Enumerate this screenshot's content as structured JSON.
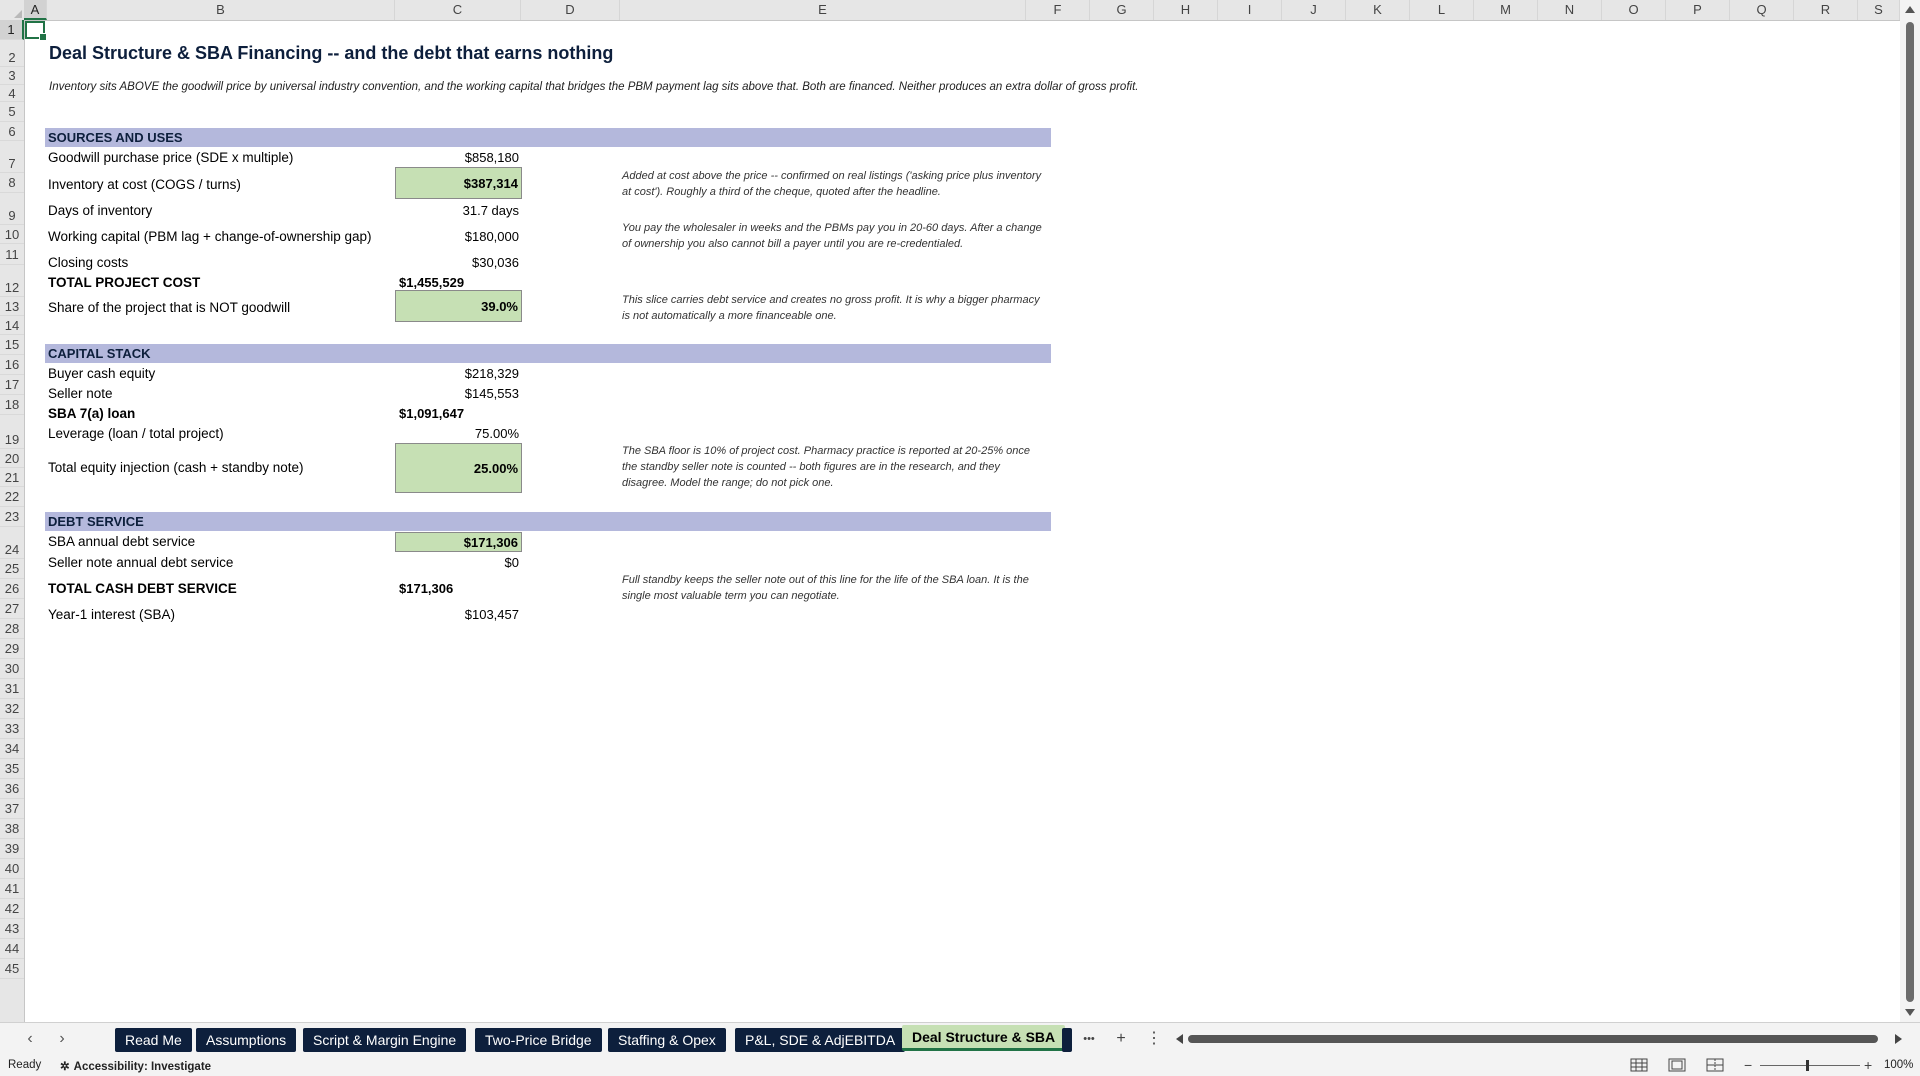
{
  "columns": [
    "A",
    "B",
    "C",
    "D",
    "E",
    "F",
    "G",
    "H",
    "I",
    "J",
    "K",
    "L",
    "M",
    "N",
    "O",
    "P",
    "Q",
    "R",
    "S"
  ],
  "rows": [
    "1",
    "2",
    "3",
    "4",
    "5",
    "6",
    "7",
    "8",
    "9",
    "10",
    "11",
    "12",
    "13",
    "14",
    "15",
    "16",
    "17",
    "18",
    "19",
    "20",
    "21",
    "22",
    "23",
    "24",
    "25",
    "26",
    "27",
    "28",
    "29",
    "30",
    "31",
    "32",
    "33",
    "34",
    "35",
    "36",
    "37",
    "38",
    "39",
    "40",
    "41",
    "42",
    "43",
    "44",
    "45"
  ],
  "sheet": {
    "title": "Deal Structure & SBA Financing -- and the debt that earns nothing",
    "subtitle": "Inventory sits ABOVE the goodwill price by universal industry convention, and the working capital that bridges the PBM payment lag sits above that. Both are financed. Neither produces an extra dollar of gross profit.",
    "sections": {
      "sources_uses": "SOURCES AND USES",
      "capital_stack": "CAPITAL STACK",
      "debt_service": "DEBT SERVICE"
    },
    "rows": {
      "goodwill": {
        "label": "Goodwill purchase price (SDE x multiple)",
        "value": "$858,180"
      },
      "inventory": {
        "label": "Inventory at cost (COGS / turns)",
        "value": "$387,314"
      },
      "days_inv": {
        "label": "Days of inventory",
        "value": "31.7 days"
      },
      "working_cap": {
        "label": "Working capital (PBM lag + change-of-ownership gap)",
        "value": "$180,000"
      },
      "closing": {
        "label": "Closing costs",
        "value": "$30,036"
      },
      "total_project": {
        "label": "TOTAL PROJECT COST",
        "value": "$1,455,529"
      },
      "not_goodwill": {
        "label": "Share of the project that is NOT goodwill",
        "value": "39.0%"
      },
      "buyer_cash": {
        "label": "Buyer cash equity",
        "value": "$218,329"
      },
      "seller_note": {
        "label": "Seller note",
        "value": "$145,553"
      },
      "sba_loan": {
        "label": "SBA 7(a) loan",
        "value": "$1,091,647"
      },
      "leverage": {
        "label": "Leverage (loan / total project)",
        "value": "75.00%"
      },
      "equity_injection": {
        "label": "Total equity injection (cash + standby note)",
        "value": "25.00%"
      },
      "sba_ds": {
        "label": "SBA annual debt service",
        "value": "$171,306"
      },
      "seller_ds": {
        "label": "Seller note annual debt service",
        "value": "$0"
      },
      "total_ds": {
        "label": "TOTAL CASH DEBT SERVICE",
        "value": "$171,306"
      },
      "interest": {
        "label": "Year-1 interest (SBA)",
        "value": "$103,457"
      }
    },
    "notes": {
      "inventory": "Added at cost above the price -- confirmed on real listings ('asking price plus inventory at cost'). Roughly a third of the cheque, quoted after the headline.",
      "working_cap": "You pay the wholesaler in weeks and the PBMs pay you in 20-60 days. After a change of ownership you also cannot bill a payer until you are re-credentialed.",
      "not_goodwill": "This slice carries debt service and creates no gross profit. It is why a bigger pharmacy is not automatically a more financeable one.",
      "equity": "The SBA floor is 10% of project cost. Pharmacy practice is reported at 20-25% once the standby seller note is counted -- both figures are in the research, and they disagree. Model the range; do not pick one.",
      "standby": "Full standby keeps the seller note out of this line for the life of the SBA loan. It is the single most valuable term you can negotiate."
    }
  },
  "tabs": [
    "Read Me",
    "Assumptions",
    "Script & Margin Engine",
    "Two-Price Bridge",
    "Staffing & Opex",
    "P&L, SDE & AdjEBITDA",
    "Deal Structure & SBA"
  ],
  "tab_controls": {
    "more": "•••",
    "add": "+",
    "menu": "⋮"
  },
  "nav": {
    "prev": "‹",
    "next": "›"
  },
  "status": {
    "ready": "Ready",
    "accessibility": "Accessibility: Investigate",
    "zoom": "100%",
    "zoom_minus": "−",
    "zoom_plus": "+"
  },
  "colors": {
    "band": "#b4b8dc",
    "highlight": "#c6e0b4",
    "tab": "#0d1f3c",
    "accent": "#217346"
  }
}
